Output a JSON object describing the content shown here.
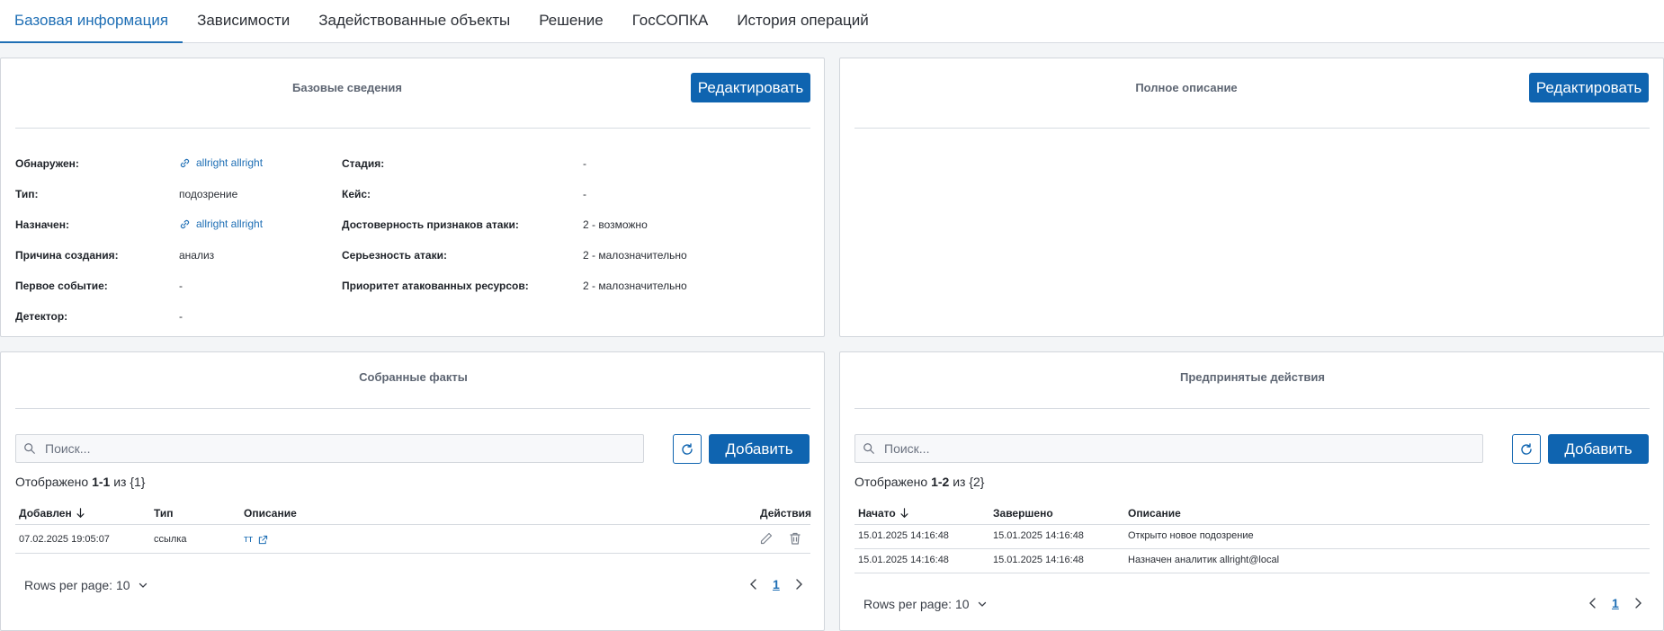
{
  "tabs": [
    {
      "label": "Базовая информация",
      "active": true
    },
    {
      "label": "Зависимости"
    },
    {
      "label": "Задействованные объекты"
    },
    {
      "label": "Решение"
    },
    {
      "label": "ГосСОПКА"
    },
    {
      "label": "История операций"
    }
  ],
  "base_info": {
    "title": "Базовые сведения",
    "edit_label": "Редактировать",
    "left": [
      {
        "label": "Обнаружен:",
        "value": "allright allright",
        "link": true
      },
      {
        "label": "Тип:",
        "value": "подозрение"
      },
      {
        "label": "Назначен:",
        "value": "allright allright",
        "link": true
      },
      {
        "label": "Причина создания:",
        "value": "анализ"
      },
      {
        "label": "Первое событие:",
        "value": "-"
      },
      {
        "label": "Детектор:",
        "value": "-"
      }
    ],
    "right": [
      {
        "label": "Стадия:",
        "value": "-"
      },
      {
        "label": "Кейс:",
        "value": "-"
      },
      {
        "label": "Достоверность признаков атаки:",
        "value": "2 - возможно"
      },
      {
        "label": "Серьезность атаки:",
        "value": "2 - малозначительно"
      },
      {
        "label": "Приоритет атакованных ресурсов:",
        "value": "2 - малозначительно"
      }
    ]
  },
  "full_desc": {
    "title": "Полное описание",
    "edit_label": "Редактировать"
  },
  "facts": {
    "title": "Собранные факты",
    "search_placeholder": "Поиск...",
    "add_label": "Добавить",
    "count_prefix": "Отображено ",
    "count_range": "1-1",
    "count_suffix": " из {1}",
    "columns": [
      "Добавлен",
      "Тип",
      "Описание",
      "Действия"
    ],
    "rows": [
      {
        "added": "07.02.2025 19:05:07",
        "type": "ссылка",
        "desc": "тт"
      }
    ],
    "rows_per_page": "Rows per page: 10",
    "page": "1"
  },
  "actions": {
    "title": "Предпринятые действия",
    "search_placeholder": "Поиск...",
    "add_label": "Добавить",
    "count_prefix": "Отображено ",
    "count_range": "1-2",
    "count_suffix": " из {2}",
    "columns": [
      "Начато",
      "Завершено",
      "Описание"
    ],
    "rows": [
      {
        "start": "15.01.2025 14:16:48",
        "end": "15.01.2025 14:16:48",
        "desc": "Открыто новое подозрение"
      },
      {
        "start": "15.01.2025 14:16:48",
        "end": "15.01.2025 14:16:48",
        "desc": "Назначен аналитик allright@local"
      }
    ],
    "rows_per_page": "Rows per page: 10",
    "page": "1"
  },
  "colors": {
    "accent": "#0f64b0",
    "link": "#1f6fb5",
    "border": "#d2d6dc"
  }
}
